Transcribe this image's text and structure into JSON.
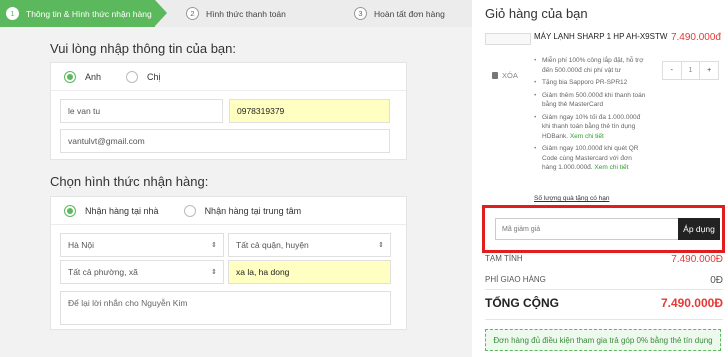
{
  "stepper": {
    "steps": [
      {
        "num": "1",
        "label": "Thông tin & Hình thức nhận hàng"
      },
      {
        "num": "2",
        "label": "Hình thức thanh toán"
      },
      {
        "num": "3",
        "label": "Hoàn tất đơn hàng"
      }
    ]
  },
  "info": {
    "title": "Vui lòng nhập thông tin của bạn:",
    "gender_options": [
      "Anh",
      "Chị"
    ],
    "gender_selected": "Anh",
    "name_value": "le van tu",
    "phone_value": "0978319379",
    "email_value": "vantulvt@gmail.com"
  },
  "delivery": {
    "title": "Chọn hình thức nhận hàng:",
    "options": [
      "Nhận hàng tại nhà",
      "Nhận hàng tại trung tâm"
    ],
    "selected": "Nhận hàng tại nhà",
    "city": "Hà Nội",
    "district_placeholder": "Tất cả quận, huyện",
    "ward_placeholder": "Tất cả phường, xã",
    "address_value": "xa la, ha dong",
    "note_placeholder": "Để lại lời nhắn cho Nguyễn Kim"
  },
  "cart": {
    "title": "Giỏ hàng của bạn",
    "product": {
      "name": "MÁY LẠNH SHARP 1 HP AH-X9STW",
      "price": "7.490.000đ",
      "remove_label": "XÓA",
      "qty_minus": "-",
      "qty_value": "1",
      "qty_plus": "+",
      "promos": [
        {
          "text": "Miễn phí 100% công lắp đặt, hỗ trợ đến 500.000đ chi phí vật tư",
          "link": ""
        },
        {
          "text": "Tặng bia Sapporo PR-SPR12",
          "link": ""
        },
        {
          "text": "Giảm thêm 500.000đ khi thanh toán bằng thẻ MasterCard",
          "link": ""
        },
        {
          "text": "Giảm ngay 10% tối đa 1.000.000đ khi thanh toán bằng thẻ tín dụng HDBank.",
          "link": "Xem chi tiết"
        },
        {
          "text": "Giảm ngay 100.000đ khi quét QR Code cùng Mastercard với đơn hàng 1.000.000đ.",
          "link": "Xem chi tiết"
        }
      ],
      "gift_limit": "Số lượng quà tặng có hạn"
    },
    "coupon": {
      "placeholder": "Mã giảm giá",
      "apply_label": "Áp dụng"
    },
    "subtotal_label": "TẠM TÍNH",
    "subtotal_value": "7.490.000đ",
    "shipping_label": "PHÍ GIAO HÀNG",
    "shipping_value": "0đ",
    "total_label": "TỔNG CỘNG",
    "total_value": "7.490.000Đ",
    "installment_note": "Đơn hàng đủ điều kiện tham gia trả góp 0% bằng thẻ tín dụng"
  },
  "colors": {
    "accent_green": "#5cb85c",
    "price_red": "#e53935",
    "highlight_yellow": "#ffffc2",
    "coupon_border_red": "#e11d1d"
  }
}
